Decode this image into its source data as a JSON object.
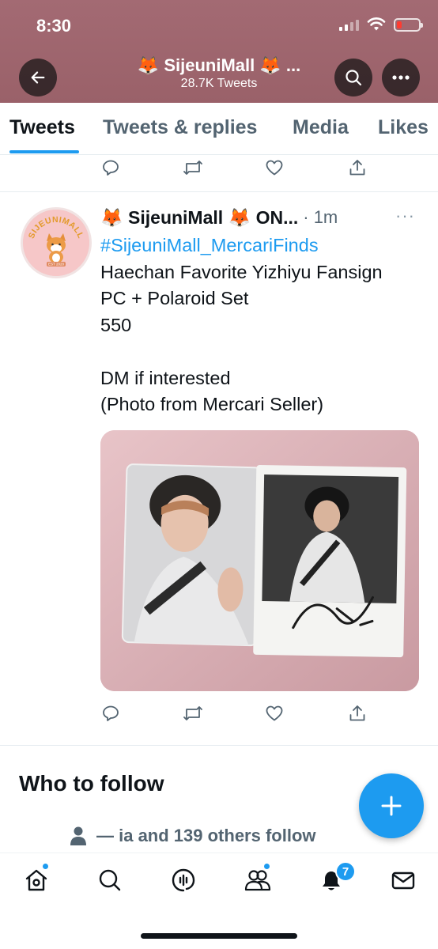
{
  "status_bar": {
    "time": "8:30"
  },
  "header": {
    "title": "🦊 SijeuniMall 🦊 ...",
    "tweet_count": "28.7K Tweets"
  },
  "tabs": [
    {
      "label": "Tweets",
      "active": true
    },
    {
      "label": "Tweets & replies",
      "active": false
    },
    {
      "label": "Media",
      "active": false
    },
    {
      "label": "Likes",
      "active": false
    }
  ],
  "tweet": {
    "avatar_text": "SIJEUNIMALL",
    "avatar_est": "EST 2020",
    "display_name": "🦊 SijeuniMall 🦊 ON...",
    "time": "· 1m",
    "more": "···",
    "hashtag": "#SijeuniMall_MercariFinds",
    "lines": [
      "Haechan Favorite Yizhiyu Fansign",
      "PC + Polaroid Set",
      "550",
      "",
      "DM if interested",
      "(Photo from Mercari Seller)"
    ]
  },
  "who_to_follow": {
    "title": "Who to follow",
    "social_context": "— ia and 139 others follow"
  },
  "bottom_nav": {
    "notifications_badge": "7",
    "items": [
      "home-icon",
      "explore-icon",
      "spaces-icon",
      "communities-icon",
      "notifications-icon",
      "messages-icon"
    ]
  },
  "colors": {
    "accent": "#1d9bf0",
    "header_bg": "#9e646c",
    "text_primary": "#0f1419",
    "text_secondary": "#536471"
  }
}
